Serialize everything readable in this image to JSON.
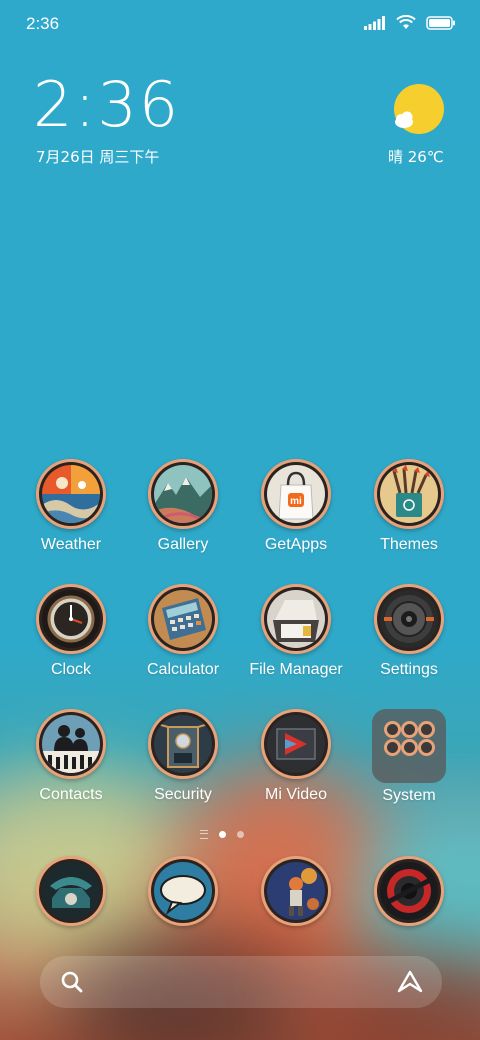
{
  "status_bar": {
    "time": "2:36",
    "icons": [
      "signal-icon",
      "wifi-icon",
      "battery-icon"
    ]
  },
  "clock_widget": {
    "time": "2:36",
    "date": "7月26日 周三下午"
  },
  "weather_widget": {
    "icon": "sun-cloud-icon",
    "text": "晴 26℃"
  },
  "apps": [
    {
      "label": "Weather",
      "icon": "weather-icon"
    },
    {
      "label": "Gallery",
      "icon": "gallery-icon"
    },
    {
      "label": "GetApps",
      "icon": "getapps-icon"
    },
    {
      "label": "Themes",
      "icon": "themes-icon"
    },
    {
      "label": "Clock",
      "icon": "clock-icon"
    },
    {
      "label": "Calculator",
      "icon": "calculator-icon"
    },
    {
      "label": "File Manager",
      "icon": "file-manager-icon"
    },
    {
      "label": "Settings",
      "icon": "settings-icon"
    },
    {
      "label": "Contacts",
      "icon": "contacts-icon"
    },
    {
      "label": "Security",
      "icon": "security-icon"
    },
    {
      "label": "Mi Video",
      "icon": "mi-video-icon"
    },
    {
      "label": "System",
      "icon": "folder-icon"
    }
  ],
  "page_indicator": {
    "pages": 2,
    "current": 1
  },
  "dock": [
    {
      "icon": "phone-icon"
    },
    {
      "icon": "messages-icon"
    },
    {
      "icon": "browser-icon"
    },
    {
      "icon": "camera-icon"
    }
  ],
  "search_bar": {
    "left_icon": "search-icon",
    "right_icon": "assistant-icon"
  },
  "colors": {
    "wallpaper_top": "#2ea9cb",
    "icon_ring": "#e8a27a",
    "sun": "#f6cf2e"
  }
}
